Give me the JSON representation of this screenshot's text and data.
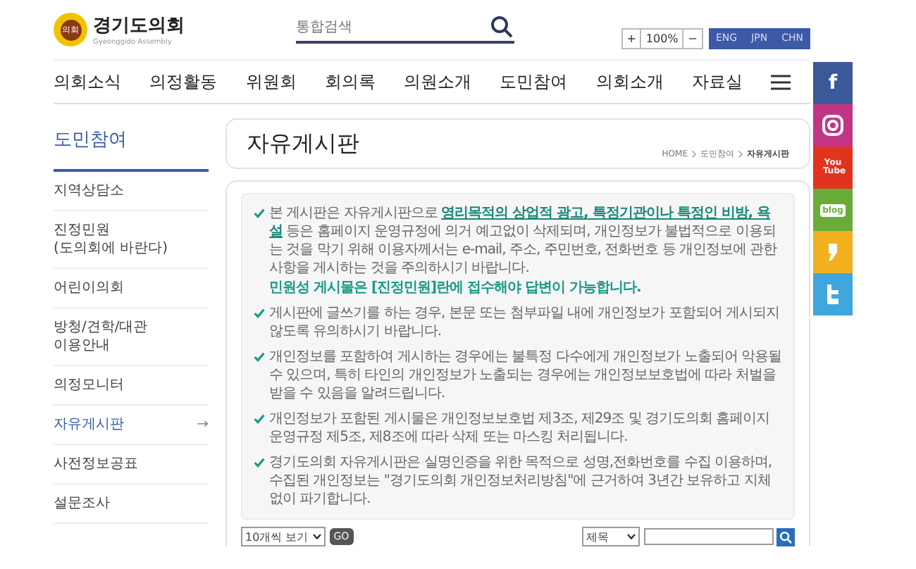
{
  "header": {
    "logo": {
      "emblem_text": "의회",
      "title": "경기도의회",
      "subtitle": "Gyeonggido Assembly"
    },
    "search": {
      "placeholder": "통합검색"
    },
    "zoom": {
      "increase": "+",
      "level": "100%",
      "decrease": "−"
    },
    "languages": [
      "ENG",
      "JPN",
      "CHN"
    ]
  },
  "nav": {
    "items": [
      "의회소식",
      "의정활동",
      "위원회",
      "회의록",
      "의원소개",
      "도민참여",
      "의회소개",
      "자료실"
    ]
  },
  "social": [
    {
      "kind": "facebook",
      "label": "f"
    },
    {
      "kind": "instagram"
    },
    {
      "kind": "youtube",
      "label": "You Tube"
    },
    {
      "kind": "blog",
      "label": "blog"
    },
    {
      "kind": "story"
    },
    {
      "kind": "twitter"
    }
  ],
  "sidebar": {
    "title": "도민참여",
    "items": [
      {
        "lines": [
          "지역상담소"
        ],
        "selected": false
      },
      {
        "lines": [
          "진정민원",
          "(도의회에 바란다)"
        ],
        "selected": false
      },
      {
        "lines": [
          "어린이의회"
        ],
        "selected": false
      },
      {
        "lines": [
          "방청/견학/대관",
          "이용안내"
        ],
        "selected": false
      },
      {
        "lines": [
          "의정모니터"
        ],
        "selected": false
      },
      {
        "lines": [
          "자유게시판"
        ],
        "selected": true,
        "arrow": "→"
      },
      {
        "lines": [
          "사전정보공표"
        ],
        "selected": false
      },
      {
        "lines": [
          "설문조사"
        ],
        "selected": false
      }
    ]
  },
  "page": {
    "title": "자유게시판",
    "breadcrumb": [
      "HOME",
      "도민참여",
      "자유게시판"
    ]
  },
  "notices": [
    {
      "text": "본 게시판은 자유게시판으로 **영리목적의 상업적 광고, 특정기관이나 특정인 비방, 욕설** 등은 홈페이지 운영규정에 의거 예고없이 삭제되며, 개인정보가 불법적으로 이용되는 것을 막기 위해 이용자께서는 e-mail, 주소, 주민번호, 전화번호 등 개인정보에 관한 사항을 게시하는 것을 주의하시기 바랍니다.",
      "note": "민원성 게시물은 [진정민원]란에 접수해야 답변이 가능합니다."
    },
    {
      "text": "게시판에 글쓰기를 하는 경우, 본문 또는 첨부파일 내에 개인정보가 포함되어 게시되지 않도록 유의하시기 바랍니다."
    },
    {
      "text": "개인정보를 포함하여 게시하는 경우에는 불특정 다수에게 개인정보가 노출되어 악용될 수 있으며, 특히 타인의 개인정보가 노출되는 경우에는 개인정보보호법에 따라 처벌을 받을 수 있음을 알려드립니다."
    },
    {
      "text": "개인정보가 포함된 게시물은 개인정보보호법 제3조, 제29조 및 경기도의회 홈페이지 운영규정 제5조, 제8조에 따라 삭제 또는 마스킹 처리됩니다."
    },
    {
      "text": "경기도의회 자유게시판은 실명인증을 위한 목적으로 성명,전화번호를 수집 이용하며, 수집된 개인정보는 \"경기도의회 개인정보처리방침\"에 근거하여 3년간 보유하고 지체없이 파기합니다."
    }
  ],
  "list_controls": {
    "page_size": "10개씩 보기",
    "go": "GO",
    "search_field": "제목"
  }
}
